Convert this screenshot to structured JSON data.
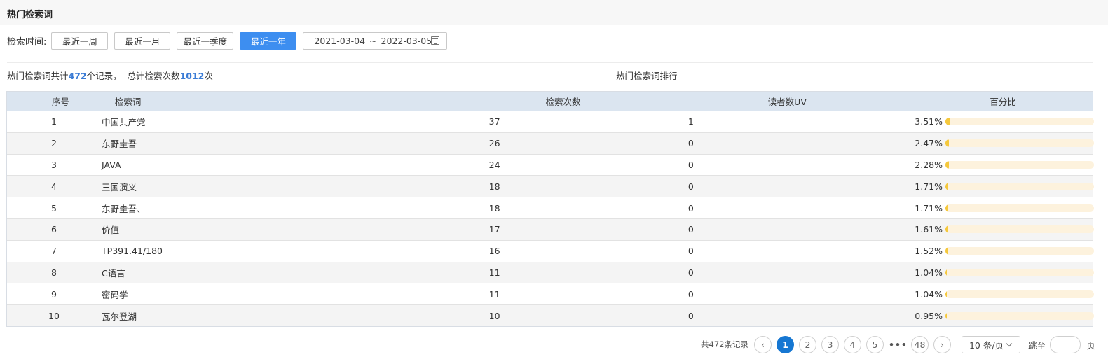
{
  "header": {
    "title": "热门检索词"
  },
  "filter": {
    "label": "检索时间:",
    "ranges": [
      {
        "label": "最近一周",
        "active": false
      },
      {
        "label": "最近一月",
        "active": false
      },
      {
        "label": "最近一季度",
        "active": false
      },
      {
        "label": "最近一年",
        "active": true
      }
    ],
    "date_start": "2021-03-04",
    "date_sep": "~",
    "date_end": "2022-03-05",
    "date_icon": "calendar-icon"
  },
  "summary": {
    "prefix": "热门检索词共计",
    "record_count": "472",
    "middle": "个记录，  总计检索次数",
    "search_total": "1012",
    "suffix": "次",
    "rank_title": "热门检索词排行"
  },
  "table": {
    "columns": [
      "序号",
      "检索词",
      "检索次数",
      "读者数UV",
      "百分比"
    ],
    "rows": [
      {
        "idx": "1",
        "term": "中国共产党",
        "count": "37",
        "uv": "1",
        "pct": "3.51%",
        "ratio": 0.0351
      },
      {
        "idx": "2",
        "term": "东野圭吾",
        "count": "26",
        "uv": "0",
        "pct": "2.47%",
        "ratio": 0.0247
      },
      {
        "idx": "3",
        "term": "JAVA",
        "count": "24",
        "uv": "0",
        "pct": "2.28%",
        "ratio": 0.0228
      },
      {
        "idx": "4",
        "term": "三国演义",
        "count": "18",
        "uv": "0",
        "pct": "1.71%",
        "ratio": 0.0171
      },
      {
        "idx": "5",
        "term": "东野圭吾、",
        "count": "18",
        "uv": "0",
        "pct": "1.71%",
        "ratio": 0.0171
      },
      {
        "idx": "6",
        "term": "价值",
        "count": "17",
        "uv": "0",
        "pct": "1.61%",
        "ratio": 0.0161
      },
      {
        "idx": "7",
        "term": "TP391.41/180",
        "count": "16",
        "uv": "0",
        "pct": "1.52%",
        "ratio": 0.0152
      },
      {
        "idx": "8",
        "term": "C语言",
        "count": "11",
        "uv": "0",
        "pct": "1.04%",
        "ratio": 0.0104
      },
      {
        "idx": "9",
        "term": "密码学",
        "count": "11",
        "uv": "0",
        "pct": "1.04%",
        "ratio": 0.0104
      },
      {
        "idx": "10",
        "term": "瓦尔登湖",
        "count": "10",
        "uv": "0",
        "pct": "0.95%",
        "ratio": 0.0095
      }
    ],
    "colors": {
      "header_bg": "#dbe5f0",
      "bar_fill": "#f5c83c",
      "bar_track": "#fdf2dd"
    }
  },
  "pagination": {
    "total_text": "共472条记录",
    "prev_icon": "chevron-left-icon",
    "pages": [
      "1",
      "2",
      "3",
      "4",
      "5"
    ],
    "current": "1",
    "ellipsis": "•••",
    "last_page": "48",
    "next_icon": "chevron-right-icon",
    "page_size": "10 条/页",
    "jump_label": "跳至",
    "jump_value": "",
    "page_unit": "页",
    "accent": "#1677d2"
  }
}
